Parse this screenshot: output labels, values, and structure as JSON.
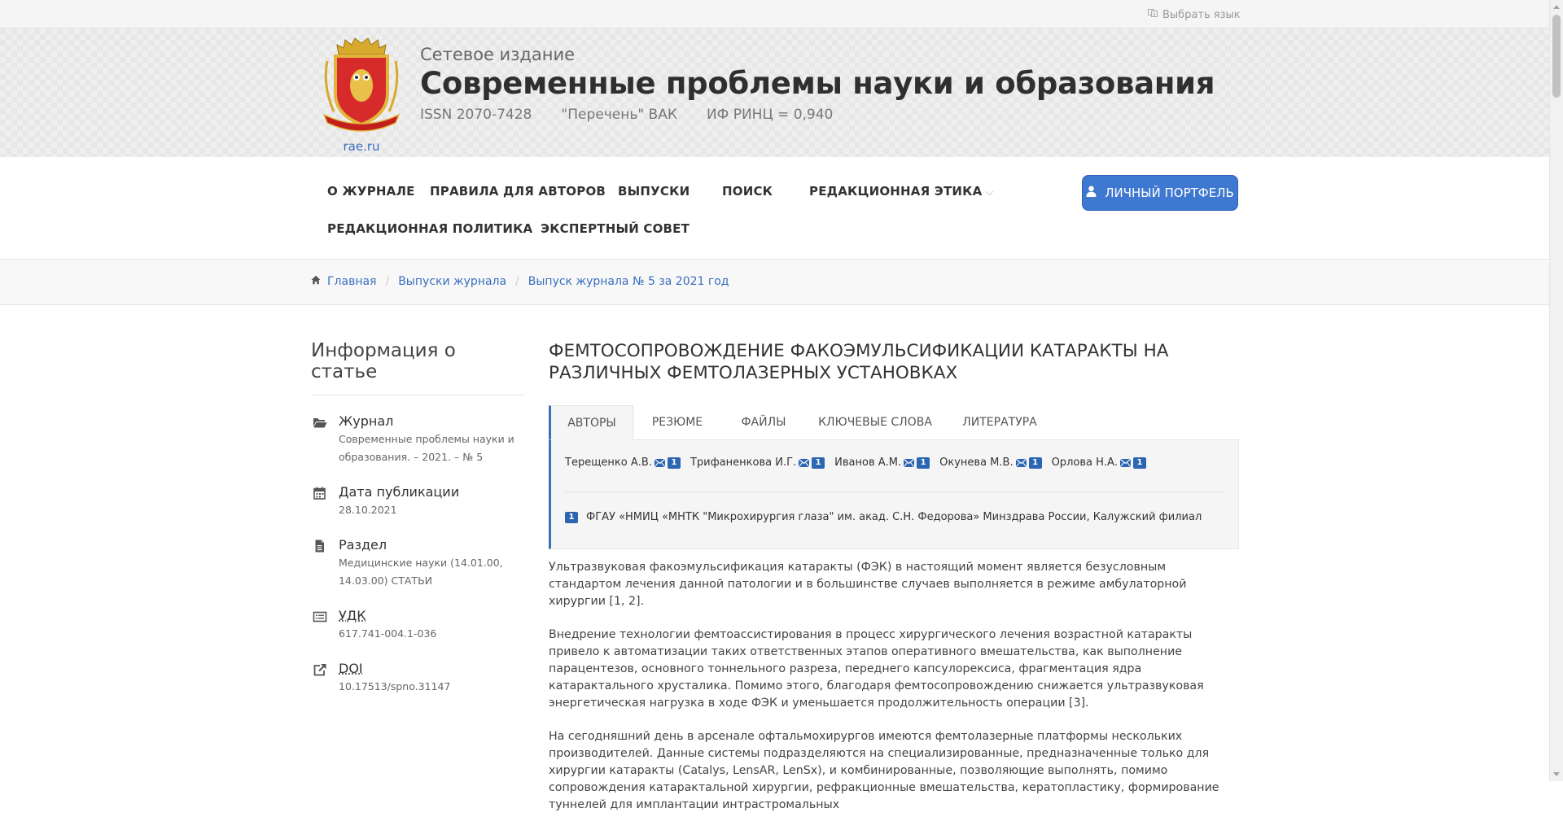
{
  "topbar": {
    "language_label": "Выбрать язык"
  },
  "header": {
    "logo_link": "rae.ru",
    "publication_type": "Сетевое издание",
    "title": "Современные проблемы науки и образования",
    "issn": "ISSN 2070-7428",
    "vak": "\"Перечень\" ВАК",
    "impact": "ИФ РИНЦ = 0,940"
  },
  "nav": {
    "items": [
      "О ЖУРНАЛЕ",
      "ПРАВИЛА ДЛЯ АВТОРОВ",
      "ВЫПУСКИ",
      "ПОИСК",
      "РЕДАКЦИОННАЯ ЭТИКА",
      "РЕДАКЦИОННАЯ ПОЛИТИКА",
      "ЭКСПЕРТНЫЙ СОВЕТ"
    ],
    "portfolio_button": "ЛИЧНЫЙ ПОРТФЕЛЬ"
  },
  "breadcrumbs": [
    "Главная",
    "Выпуски журнала",
    "Выпуск журнала № 5 за 2021 год"
  ],
  "sidebar": {
    "title": "Информация о статье",
    "items": [
      {
        "icon": "folder-open-icon",
        "label": "Журнал",
        "value": "Современные проблемы науки и образования. – 2021. – № 5"
      },
      {
        "icon": "calendar-icon",
        "label": "Дата публикации",
        "value": "28.10.2021"
      },
      {
        "icon": "file-icon",
        "label": "Раздел",
        "value": "Медицинские науки (14.01.00, 14.03.00) СТАТЬИ"
      },
      {
        "icon": "list-box-icon",
        "label": "УДК",
        "value": "617.741-004.1-036"
      },
      {
        "icon": "external-link-icon",
        "label": "DOI",
        "value": "10.17513/spno.31147"
      }
    ]
  },
  "article": {
    "title": "ФЕМТОСОПРОВОЖДЕНИЕ ФАКОЭМУЛЬСИФИКАЦИИ КАТАРАКТЫ НА РАЗЛИЧНЫХ ФЕМТОЛАЗЕРНЫХ УСТАНОВКАХ",
    "tabs": [
      "АВТОРЫ",
      "РЕЗЮМЕ",
      "ФАЙЛЫ",
      "КЛЮЧЕВЫЕ СЛОВА",
      "ЛИТЕРАТУРА"
    ],
    "active_tab": "АВТОРЫ",
    "authors": [
      {
        "name": "Терещенко А.В.",
        "affil": "1"
      },
      {
        "name": "Трифаненкова И.Г.",
        "affil": "1"
      },
      {
        "name": "Иванов А.М.",
        "affil": "1"
      },
      {
        "name": "Окунева М.В.",
        "affil": "1"
      },
      {
        "name": "Орлова Н.А.",
        "affil": "1"
      }
    ],
    "affiliation": {
      "num": "1",
      "text": "ФГАУ «НМИЦ «МНТК \"Микрохирургия глаза\" им. акад. С.Н. Федорова» Минздрава России, Калужский филиал"
    },
    "paragraphs": [
      "Ультразвуковая факоэмульсификация катаракты (ФЭК) в настоящий момент является безусловным стандартом лечения данной патологии и в большинстве случаев выполняется в режиме амбулаторной хирургии [1, 2].",
      "Внедрение технологии фемтоассистирования в процесс хирургического лечения возрастной катаракты привело к автоматизации таких ответственных этапов оперативного вмешательства, как выполнение парацентезов, основного тоннельного разреза, переднего капсулорексиса, фрагментация ядра катарактального хрусталика. Помимо этого, благодаря фемтосопровождению снижается ультразвуковая энергетическая нагрузка в ходе ФЭК и уменьшается продолжительность операции [3].",
      "На сегодняшний день в арсенале офтальмохирургов имеются фемтолазерные платформы нескольких производителей. Данные системы подразделяются на специализированные, предназначенные только для хирургии катаракты (Catalys, LensAR, LenSx), и комбинированные, позволяющие выполнять, помимо сопровождения катарактальной хирургии, рефракционные вмешательства, кератопластику, формирование туннелей для имплантации интрастромальных"
    ]
  },
  "colors": {
    "accent": "#3e78d0",
    "link": "#3a6fbe",
    "badge": "#2c66b3"
  }
}
